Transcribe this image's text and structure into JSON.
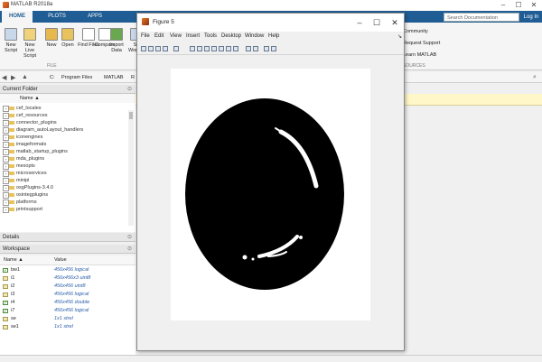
{
  "matlab": {
    "title": "MATLAB R2018a",
    "tabs": [
      "HOME",
      "PLOTS",
      "APPS"
    ],
    "ribbon_buttons": [
      {
        "label1": "New",
        "label2": "Script",
        "icon": "new-script-icon",
        "color": "#c8d7ea"
      },
      {
        "label1": "New",
        "label2": "Live Script",
        "icon": "new-live-script-icon",
        "color": "#f0d27a"
      },
      {
        "label1": "New",
        "label2": "",
        "icon": "new-icon",
        "color": "#e7b84b"
      },
      {
        "label1": "Open",
        "label2": "",
        "icon": "open-folder-icon",
        "color": "#e8c25a"
      },
      {
        "label1": "Find Files",
        "label2": "",
        "icon": "find-files-icon",
        "color": "#ffffff"
      },
      {
        "label1": "Compare",
        "label2": "",
        "icon": "compare-icon",
        "color": "#ffffff"
      },
      {
        "label1": "Import",
        "label2": "Data",
        "icon": "import-data-icon",
        "color": "#6aa84f"
      },
      {
        "label1": "Sa",
        "label2": "Worksp",
        "icon": "save-workspace-icon",
        "color": "#c8d7ea"
      }
    ],
    "file_section": "FILE",
    "resources_section": "SOURCES",
    "resources": [
      "Community",
      "Request Support",
      "Learn MATLAB"
    ],
    "search_placeholder": "Search Documentation",
    "login_label": "Log In",
    "path": [
      "C:",
      "Program Files",
      "MATLAB",
      "R"
    ]
  },
  "current_folder": {
    "header": "Current Folder",
    "column": "Name ▲",
    "items": [
      "cef_locales",
      "cef_resources",
      "connector_plugins",
      "diagram_autoLayout_handlers",
      "iconengines",
      "imageformats",
      "matlab_startup_plugins",
      "mda_plugins",
      "mexopts",
      "microservices",
      "minipi",
      "osgPlugins-3.4.0",
      "osintegplugins",
      "platforms",
      "printsupport"
    ]
  },
  "details": {
    "header": "Details"
  },
  "workspace": {
    "header": "Workspace",
    "columns": [
      "Name ▲",
      "Value"
    ],
    "rows": [
      {
        "name": "bw1",
        "value": "456x456 logical",
        "checked": true
      },
      {
        "name": "i1",
        "value": "456x456x3 uint8",
        "checked": false
      },
      {
        "name": "i2",
        "value": "456x456 uint8",
        "checked": false
      },
      {
        "name": "i3",
        "value": "456x456 logical",
        "checked": false
      },
      {
        "name": "i4",
        "value": "456x456 double",
        "checked": true
      },
      {
        "name": "i7",
        "value": "456x456 logical",
        "checked": true
      },
      {
        "name": "se",
        "value": "1x1 strel",
        "checked": false
      },
      {
        "name": "se1",
        "value": "1x1 strel",
        "checked": false
      }
    ]
  },
  "figure": {
    "title": "Figure 5",
    "menu": [
      "File",
      "Edit",
      "View",
      "Insert",
      "Tools",
      "Desktop",
      "Window",
      "Help"
    ],
    "toolbar_icons": [
      "new-figure-icon",
      "open-file-icon",
      "save-icon",
      "print-icon",
      "pointer-icon",
      "zoom-in-icon",
      "zoom-out-icon",
      "pan-icon",
      "rotate-icon",
      "data-cursor-icon",
      "brush-icon",
      "link-icon",
      "colorbar-icon",
      "legend-icon",
      "hide-plot-tools-icon",
      "show-plot-tools-icon"
    ]
  },
  "colors": {
    "ribbon_blue": "#1f5d94",
    "figure_bg": "#f0f0f0",
    "blob": "#000000"
  }
}
